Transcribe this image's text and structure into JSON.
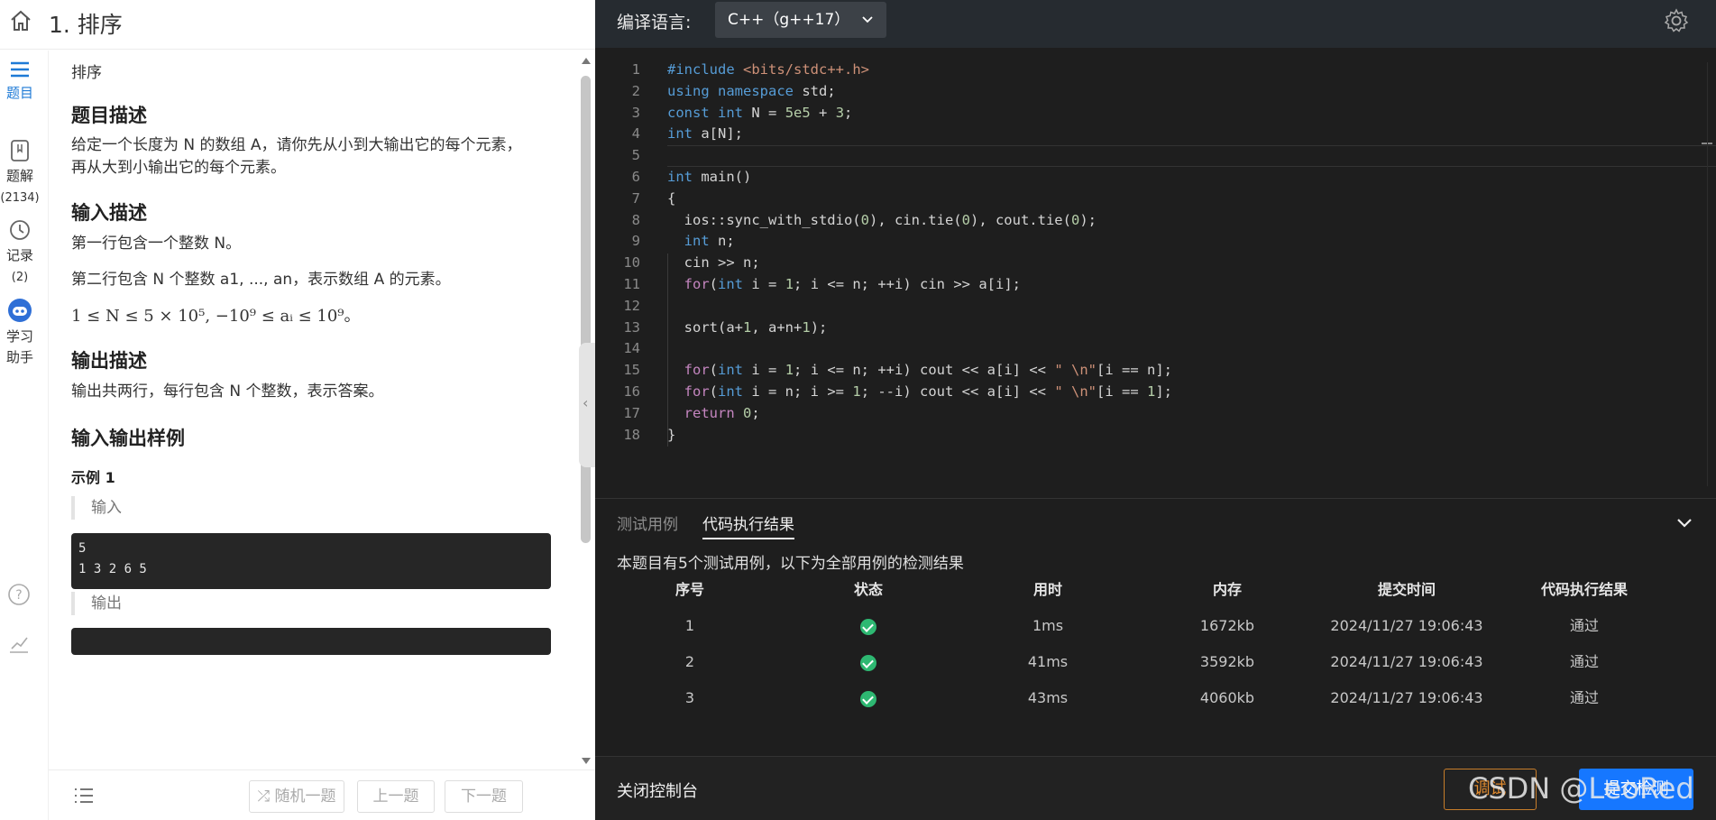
{
  "header": {
    "title": "1. 排序"
  },
  "rail": [
    {
      "label": "题目",
      "icon": "list-icon",
      "active": true
    },
    {
      "label": "题解",
      "count": "(2134)",
      "icon": "solution-icon"
    },
    {
      "label": "记录",
      "count": "(2)",
      "icon": "history-icon"
    },
    {
      "label": "学习助手",
      "icon": "robot-icon"
    }
  ],
  "rail_bottom": {
    "help_icon": "help-icon",
    "stats_icon": "stats-icon"
  },
  "problem": {
    "crumb": "排序",
    "desc_heading": "题目描述",
    "desc_line1": "给定一个长度为 N 的数组 A，请你先从小到大输出它的每个元素，",
    "desc_line2": "再从大到小输出它的每个元素。",
    "input_heading": "输入描述",
    "input_line1": "第一行包含一个整数 N。",
    "input_line2": "第二行包含 N 个整数 a1, ..., an，表示数组 A 的元素。",
    "constraint": "1 ≤ N ≤ 5 × 10⁵, −10⁹ ≤ aᵢ ≤ 10⁹。",
    "output_heading": "输出描述",
    "output_line": "输出共两行，每行包含 N 个整数，表示答案。",
    "io_heading": "输入输出样例",
    "example_heading": "示例 1",
    "input_label": "输入",
    "sample_input": "5\n1 3 2 6 5",
    "output_label": "输出"
  },
  "bottom_nav": {
    "random": "随机一题",
    "prev": "上一题",
    "next": "下一题"
  },
  "editor": {
    "lang_label": "编译语言:",
    "lang_value": "C++（g++17）",
    "line_numbers": [
      "1",
      "2",
      "3",
      "4",
      "5",
      "6",
      "7",
      "8",
      "9",
      "10",
      "11",
      "12",
      "13",
      "14",
      "15",
      "16",
      "17",
      "18"
    ]
  },
  "console": {
    "tab_testcases": "测试用例",
    "tab_result": "代码执行结果",
    "summary": "本题目有5个测试用例，以下为全部用例的检测结果",
    "headers": [
      "序号",
      "状态",
      "用时",
      "内存",
      "提交时间",
      "代码执行结果"
    ],
    "rows": [
      {
        "id": "1",
        "status": "passed",
        "time": "1ms",
        "memory": "1672kb",
        "submitted": "2024/11/27 19:06:43",
        "result": "通过"
      },
      {
        "id": "2",
        "status": "passed",
        "time": "41ms",
        "memory": "3592kb",
        "submitted": "2024/11/27 19:06:43",
        "result": "通过"
      },
      {
        "id": "3",
        "status": "passed",
        "time": "43ms",
        "memory": "4060kb",
        "submitted": "2024/11/27 19:06:43",
        "result": "通过"
      }
    ]
  },
  "footer": {
    "close_console": "关闭控制台",
    "debug": "调试",
    "submit": "提交检测",
    "watermark": "CSDN @LeoRed"
  },
  "colors": {
    "accent": "#1677ff",
    "success": "#2eb872",
    "debug": "#e08a2e"
  }
}
